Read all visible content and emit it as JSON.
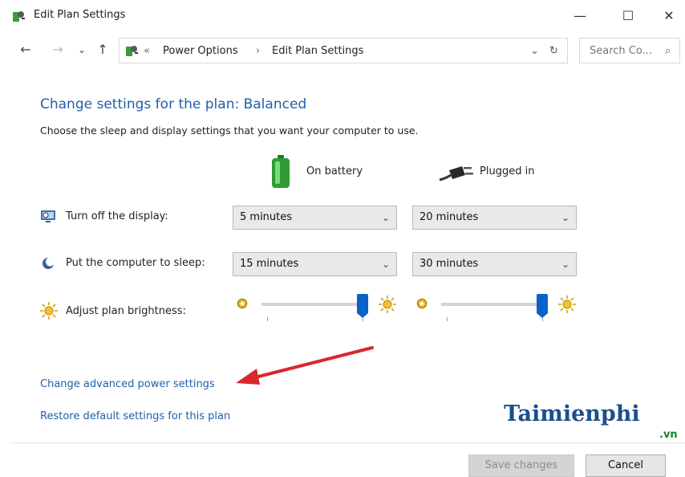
{
  "window": {
    "title": "Edit Plan Settings",
    "minimize": "—",
    "maximize": "☐",
    "close": "✕"
  },
  "nav": {
    "back": "←",
    "forward": "→",
    "recent": "⌄",
    "up": "↑",
    "crumb_prefix": "«",
    "breadcrumb": [
      "Power Options",
      "Edit Plan Settings"
    ],
    "separator": "›",
    "dropdown": "⌄",
    "refresh": "↻",
    "search_placeholder": "Search Co...",
    "search_icon": "⌕"
  },
  "content": {
    "heading": "Change settings for the plan: Balanced",
    "subtext": "Choose the sleep and display settings that you want your computer to use.",
    "columns": {
      "battery": "On battery",
      "plugged": "Plugged in"
    },
    "rows": {
      "display": {
        "label": "Turn off the display:",
        "battery": "5 minutes",
        "plugged": "20 minutes"
      },
      "sleep": {
        "label": "Put the computer to sleep:",
        "battery": "15 minutes",
        "plugged": "30 minutes"
      },
      "brightness": {
        "label": "Adjust plan brightness:",
        "battery_level": 1.0,
        "plugged_level": 1.0
      }
    },
    "links": {
      "advanced": "Change advanced power settings",
      "restore": "Restore default settings for this plan"
    },
    "annotation_color": "#d9272e"
  },
  "footer": {
    "save": "Save changes",
    "cancel": "Cancel"
  },
  "watermark": {
    "brand": "Taimienphi",
    "suffix": ".vn"
  }
}
